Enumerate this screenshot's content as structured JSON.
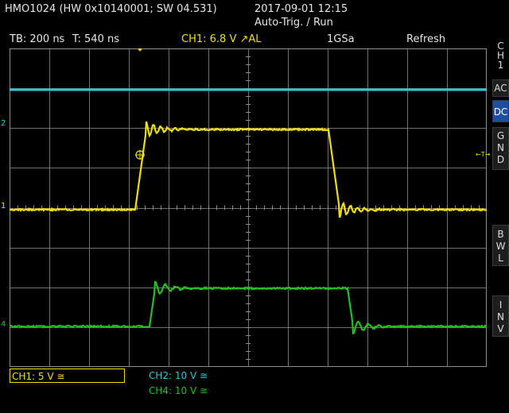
{
  "header": {
    "model_info": "HMO1024 (HW 0x10140001; SW 04.531)",
    "datetime": "2017-09-01 12:15",
    "mode": "Auto-Trig. / Run"
  },
  "status": {
    "timebase": "TB: 200 ns",
    "trigger_time": "T: 540 ns",
    "trigger": "CH1: 6.8 V ↗AL",
    "sample_rate": "1GSa",
    "acquisition": "Refresh"
  },
  "colors": {
    "ch1": "#f0e000",
    "ch2": "#2ac8d8",
    "ch4": "#22c020",
    "grid": "#8c8c8c"
  },
  "sidebar": {
    "channel": [
      "C",
      "H",
      "1"
    ],
    "ac": "AC",
    "dc": "DC",
    "gnd": [
      "G",
      "N",
      "D"
    ],
    "bwl": [
      "B",
      "W",
      "L"
    ],
    "inv": [
      "I",
      "N",
      "V"
    ]
  },
  "channels": {
    "ch1": "CH1: 5 V ≅",
    "ch2": "CH2: 10 V ≅",
    "ch4": "CH4: 10 V ≅"
  },
  "markers": {
    "ch1": "1",
    "ch2": "2",
    "ch4": "4",
    "trigger_level": "←T→"
  },
  "chart_data": {
    "type": "line",
    "grid": true,
    "x_divisions": 12,
    "y_divisions": 8,
    "series": [
      {
        "name": "CH1",
        "color": "#f0e000"
      },
      {
        "name": "CH2",
        "color": "#2ac8d8"
      },
      {
        "name": "CH4",
        "color": "#22c020"
      }
    ]
  }
}
